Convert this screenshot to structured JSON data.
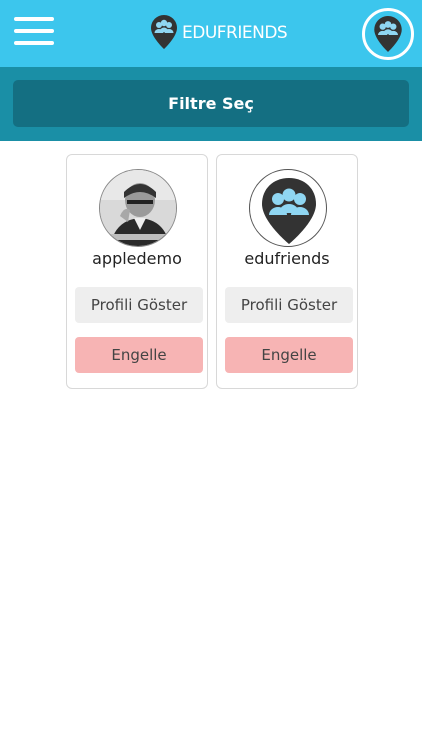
{
  "header": {
    "brand_name": "EDUFRIENDS",
    "menu_icon": "hamburger-menu-icon",
    "avatar_icon": "edufriends-logo-icon"
  },
  "filter": {
    "label": "Filtre Seç"
  },
  "users": [
    {
      "username": "appledemo",
      "profile_label": "Profili Göster",
      "block_label": "Engelle",
      "avatar": "photo"
    },
    {
      "username": "edufriends",
      "profile_label": "Profili Göster",
      "block_label": "Engelle",
      "avatar": "edufriends-logo"
    }
  ],
  "colors": {
    "header_bg": "#3cc6ed",
    "filter_bar_bg": "#1a8fa6",
    "filter_button_bg": "#146f82",
    "block_button_bg": "#f7b4b4",
    "profile_button_bg": "#eeeeee"
  }
}
